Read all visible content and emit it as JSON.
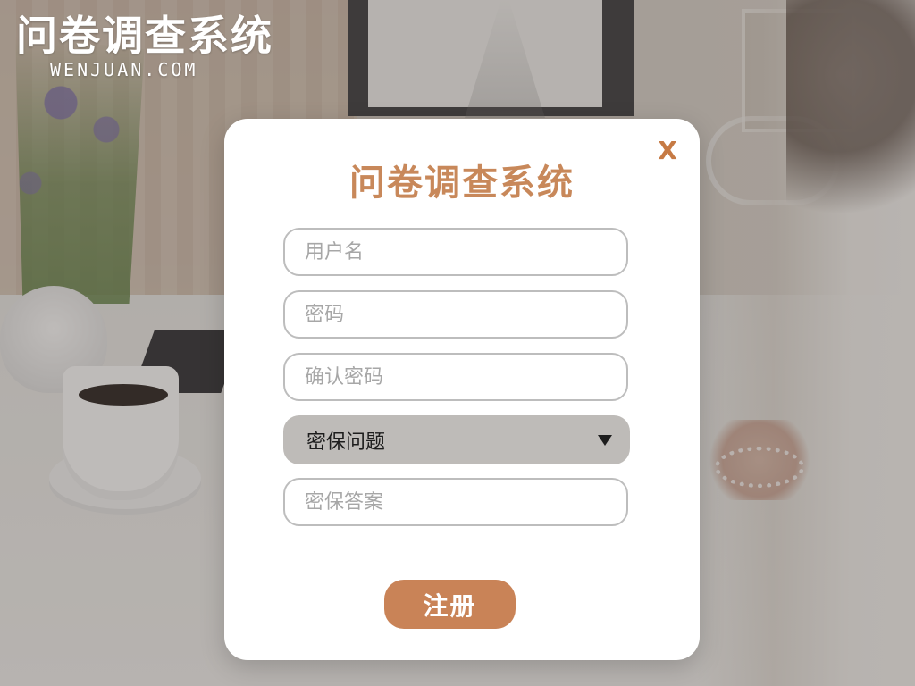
{
  "brand": {
    "title": "问卷调查系统",
    "subtitle": "WENJUAN.COM"
  },
  "modal": {
    "title": "问卷调查系统",
    "close_label": "X"
  },
  "form": {
    "username_placeholder": "用户名",
    "password_placeholder": "密码",
    "confirm_password_placeholder": "确认密码",
    "security_question_selected": "密保问题",
    "security_answer_placeholder": "密保答案"
  },
  "actions": {
    "register_label": "注册"
  },
  "colors": {
    "accent": "#c98357",
    "title": "#c8885a",
    "close": "#c67a44",
    "input_border": "#bdbdbd",
    "select_bg": "#bebbb8"
  },
  "icons": {
    "close": "close-icon",
    "dropdown": "chevron-down-icon"
  }
}
